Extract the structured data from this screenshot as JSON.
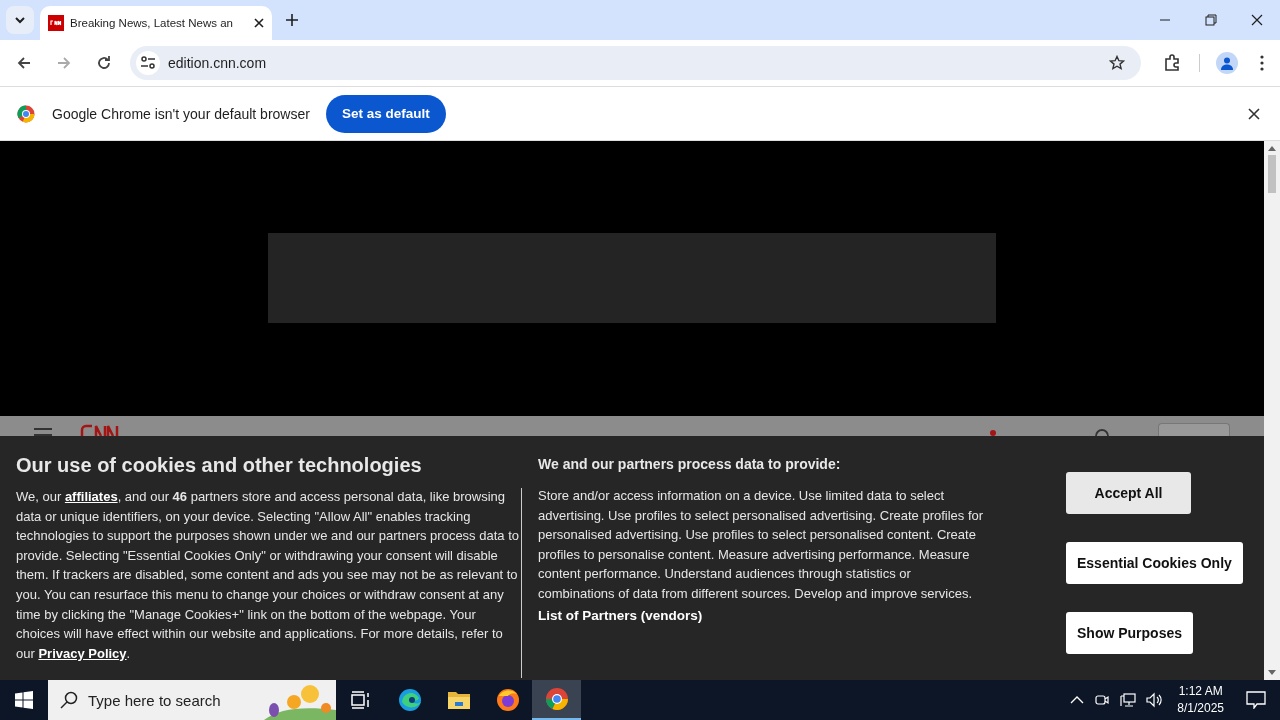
{
  "browser": {
    "tabs": [
      {
        "title": "Breaking News, Latest News an",
        "selected": true
      }
    ],
    "address": "edition.cnn.com"
  },
  "infobar": {
    "message": "Google Chrome isn't your default browser",
    "button": "Set as default"
  },
  "cookie_banner": {
    "title": "Our use of cookies and other technologies",
    "body": [
      {
        "kind": "text",
        "text": "We, our "
      },
      {
        "kind": "link",
        "text": "affiliates"
      },
      {
        "kind": "text",
        "text": ", and our "
      },
      {
        "kind": "bold",
        "text": "46"
      },
      {
        "kind": "text",
        "text": " partners store and access personal data, like browsing data or unique identifiers, on your device. Selecting \"Allow All\" enables tracking technologies to support the purposes shown under we and our partners process data to provide. Selecting \"Essential Cookies Only\" or withdrawing your consent will disable them. If trackers are disabled, some content and ads you see may not be as relevant to you. You can resurface this menu to change your choices or withdraw consent at any time by clicking the \"Manage Cookies+\" link on the bottom of the webpage. Your choices will have effect within our website and applications. For more details, refer to our "
      },
      {
        "kind": "link",
        "text": "Privacy Policy"
      },
      {
        "kind": "text",
        "text": "."
      }
    ],
    "purposes_title": "We and our partners process data to provide:",
    "purposes_text": "Store and/or access information on a device. Use limited data to select advertising. Use profiles to select personalised advertising. Create profiles for personalised advertising. Use profiles to select personalised content. Create profiles to personalise content. Measure advertising performance. Measure content performance. Understand audiences through statistics or combinations of data from different sources. Develop and improve services.",
    "partners_link": "List of Partners (vendors)",
    "buttons": [
      {
        "label": "Accept All",
        "kind": "primary"
      },
      {
        "label": "Essential Cookies Only",
        "kind": "secondary"
      },
      {
        "label": "Show Purposes",
        "kind": "secondary"
      }
    ]
  },
  "taskbar": {
    "search_placeholder": "Type here to search",
    "apps": [
      {
        "kind": "task-view",
        "selected": false
      },
      {
        "kind": "edge",
        "selected": false
      },
      {
        "kind": "explorer",
        "selected": false
      },
      {
        "kind": "firefox",
        "selected": false
      },
      {
        "kind": "chrome",
        "selected": true
      }
    ],
    "time": "1:12 AM",
    "date": "8/1/2025"
  }
}
